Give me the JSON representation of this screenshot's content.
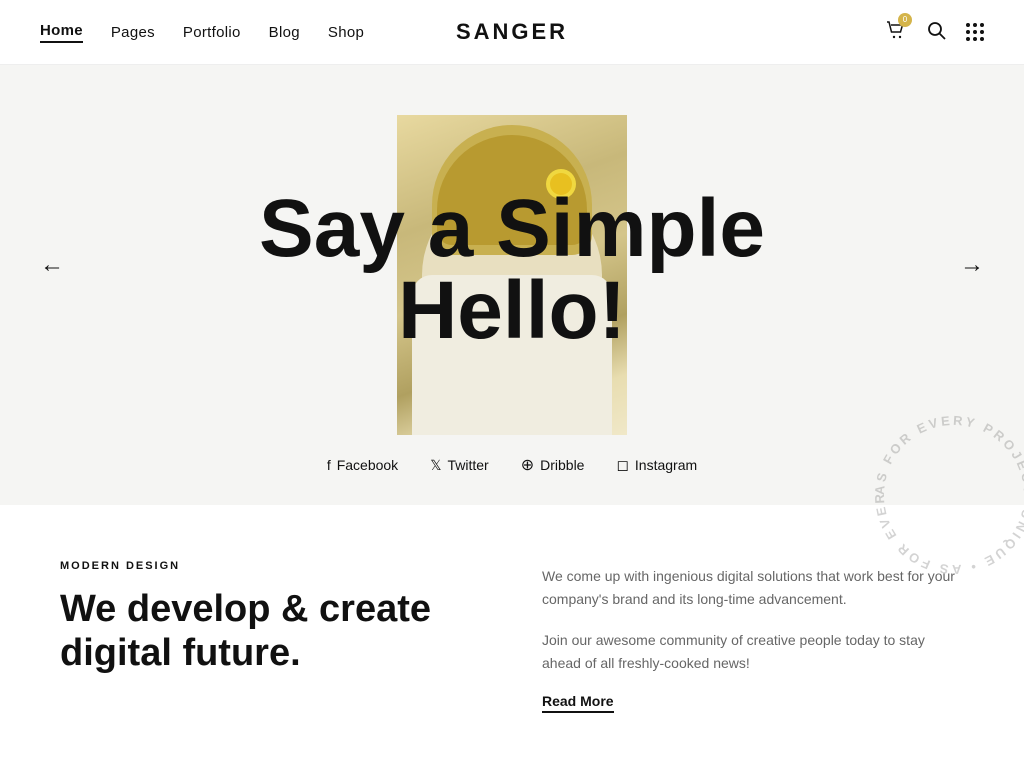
{
  "header": {
    "logo": "SANGER",
    "nav": [
      {
        "label": "Home",
        "active": true
      },
      {
        "label": "Pages",
        "active": false
      },
      {
        "label": "Portfolio",
        "active": false
      },
      {
        "label": "Blog",
        "active": false
      },
      {
        "label": "Shop",
        "active": false
      }
    ],
    "cart_badge": "0",
    "icons": {
      "cart": "🛒",
      "search": "🔍",
      "grid": "grid"
    }
  },
  "hero": {
    "headline_line1": "Say a Simple",
    "headline_line2": "Hello!",
    "arrow_left": "←",
    "arrow_right": "→",
    "social_links": [
      {
        "icon": "f",
        "label": "Facebook"
      },
      {
        "icon": "🐦",
        "label": "Twitter"
      },
      {
        "icon": "◎",
        "label": "Dribble"
      },
      {
        "icon": "◻",
        "label": "Instagram"
      }
    ],
    "circular_text": "AS FOR EVERY PROJECT. UNIQUE"
  },
  "section": {
    "tag": "MODERN DESIGN",
    "heading": "We develop & create\ndigital future.",
    "text1": "We come up with ingenious digital solutions that work best for your company's brand and its long-time advancement.",
    "text2": "Join our awesome community of creative people today to stay ahead of all freshly-cooked news!",
    "read_more": "Read More"
  }
}
